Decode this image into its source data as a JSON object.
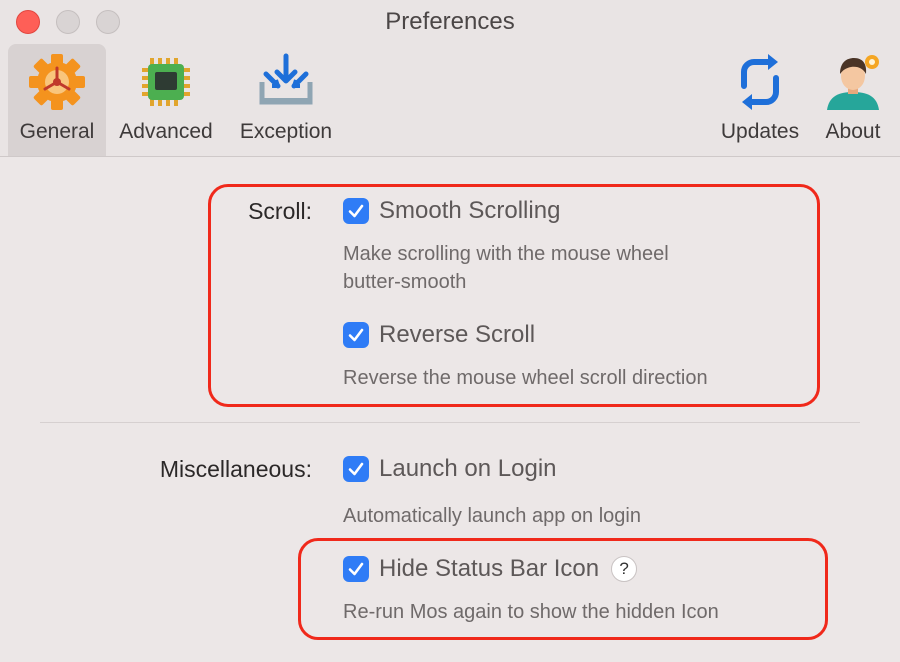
{
  "window": {
    "title": "Preferences"
  },
  "toolbar": {
    "items": [
      {
        "label": "General",
        "icon": "gear-icon",
        "selected": true
      },
      {
        "label": "Advanced",
        "icon": "chip-icon",
        "selected": false
      },
      {
        "label": "Exception",
        "icon": "inbox-download-icon",
        "selected": false
      },
      {
        "label": "Updates",
        "icon": "sync-icon",
        "selected": false
      },
      {
        "label": "About",
        "icon": "person-icon",
        "selected": false
      }
    ]
  },
  "scroll": {
    "label": "Scroll:",
    "smooth": {
      "label": "Smooth Scrolling",
      "checked": true,
      "desc_line1": "Make scrolling with the mouse wheel",
      "desc_line2": "butter-smooth"
    },
    "reverse": {
      "label": "Reverse Scroll",
      "checked": true,
      "desc": "Reverse the mouse wheel scroll direction"
    }
  },
  "misc": {
    "label": "Miscellaneous:",
    "launch": {
      "label": "Launch on Login",
      "checked": true,
      "desc": "Automatically launch app on login"
    },
    "hide_icon": {
      "label": "Hide Status Bar Icon",
      "checked": true,
      "help": "?",
      "desc": "Re-run Mos again to show the hidden Icon"
    }
  },
  "colors": {
    "checkbox": "#2f7cf6",
    "highlight": "#f0291b",
    "close_button": "#fe5f57"
  }
}
